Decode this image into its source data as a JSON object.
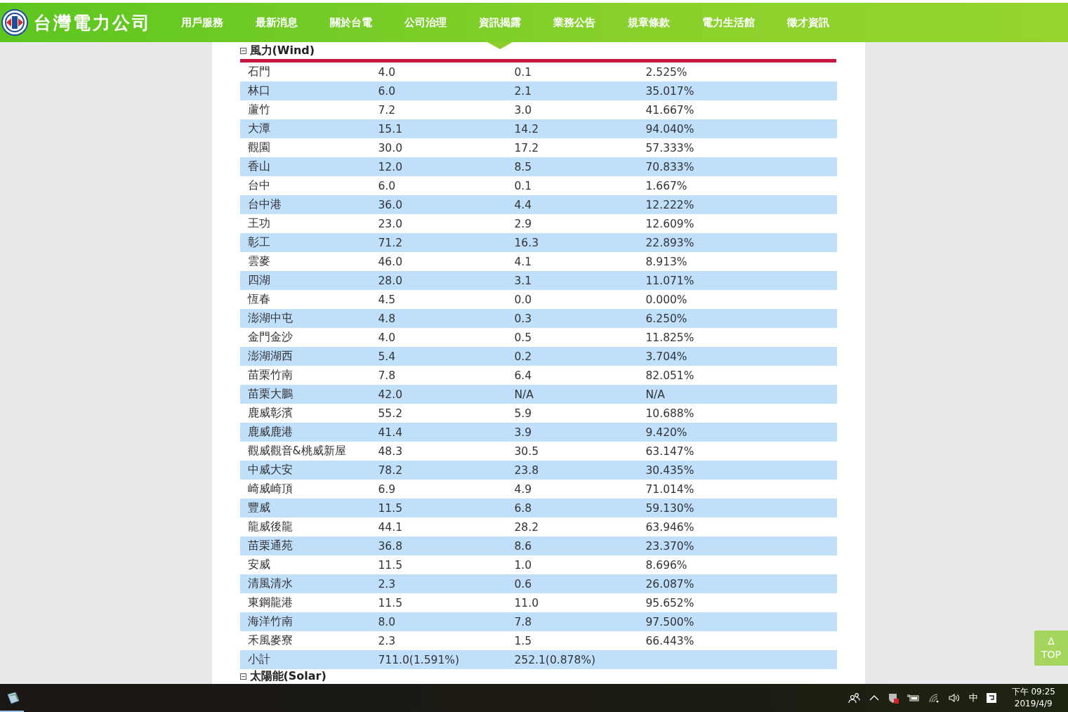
{
  "header": {
    "logo_text": "台灣電力公司",
    "nav": [
      {
        "label": "用戶服務",
        "selected": false
      },
      {
        "label": "最新消息",
        "selected": false
      },
      {
        "label": "關於台電",
        "selected": false
      },
      {
        "label": "公司治理",
        "selected": false
      },
      {
        "label": "資訊揭露",
        "selected": true
      },
      {
        "label": "業務公告",
        "selected": false
      },
      {
        "label": "規章條款",
        "selected": false
      },
      {
        "label": "電力生活館",
        "selected": false
      },
      {
        "label": "徵才資訊",
        "selected": false
      }
    ]
  },
  "sections": [
    {
      "title": "風力(Wind)",
      "expanded": true,
      "rows": [
        [
          "石門",
          "4.0",
          "0.1",
          "2.525%"
        ],
        [
          "林口",
          "6.0",
          "2.1",
          "35.017%"
        ],
        [
          "蘆竹",
          "7.2",
          "3.0",
          "41.667%"
        ],
        [
          "大潭",
          "15.1",
          "14.2",
          "94.040%"
        ],
        [
          "觀園",
          "30.0",
          "17.2",
          "57.333%"
        ],
        [
          "香山",
          "12.0",
          "8.5",
          "70.833%"
        ],
        [
          "台中",
          "6.0",
          "0.1",
          "1.667%"
        ],
        [
          "台中港",
          "36.0",
          "4.4",
          "12.222%"
        ],
        [
          "王功",
          "23.0",
          "2.9",
          "12.609%"
        ],
        [
          "彰工",
          "71.2",
          "16.3",
          "22.893%"
        ],
        [
          "雲麥",
          "46.0",
          "4.1",
          "8.913%"
        ],
        [
          "四湖",
          "28.0",
          "3.1",
          "11.071%"
        ],
        [
          "恆春",
          "4.5",
          "0.0",
          "0.000%"
        ],
        [
          "澎湖中屯",
          "4.8",
          "0.3",
          "6.250%"
        ],
        [
          "金門金沙",
          "4.0",
          "0.5",
          "11.825%"
        ],
        [
          "澎湖湖西",
          "5.4",
          "0.2",
          "3.704%"
        ],
        [
          "苗栗竹南",
          "7.8",
          "6.4",
          "82.051%"
        ],
        [
          "苗栗大鵬",
          "42.0",
          "N/A",
          "N/A"
        ],
        [
          "鹿威彰濱",
          "55.2",
          "5.9",
          "10.688%"
        ],
        [
          "鹿威鹿港",
          "41.4",
          "3.9",
          "9.420%"
        ],
        [
          "觀威觀音&桃威新屋",
          "48.3",
          "30.5",
          "63.147%"
        ],
        [
          "中威大安",
          "78.2",
          "23.8",
          "30.435%"
        ],
        [
          "崎威崎頂",
          "6.9",
          "4.9",
          "71.014%"
        ],
        [
          "豐威",
          "11.5",
          "6.8",
          "59.130%"
        ],
        [
          "龍威後龍",
          "44.1",
          "28.2",
          "63.946%"
        ],
        [
          "苗栗通苑",
          "36.8",
          "8.6",
          "23.370%"
        ],
        [
          "安威",
          "11.5",
          "1.0",
          "8.696%"
        ],
        [
          "清風清水",
          "2.3",
          "0.6",
          "26.087%"
        ],
        [
          "東鋼龍港",
          "11.5",
          "11.0",
          "95.652%"
        ],
        [
          "海洋竹南",
          "8.0",
          "7.8",
          "97.500%"
        ],
        [
          "禾風麥寮",
          "2.3",
          "1.5",
          "66.443%"
        ],
        [
          "小計",
          "711.0(1.591%)",
          "252.1(0.878%)"
        ]
      ]
    },
    {
      "title": "太陽能(Solar)",
      "expanded": true
    }
  ],
  "top_button": {
    "arrow": "Δ",
    "label": "TOP"
  },
  "taskbar": {
    "ime": "中",
    "time": "下午 09:25",
    "date": "2019/4/9"
  }
}
